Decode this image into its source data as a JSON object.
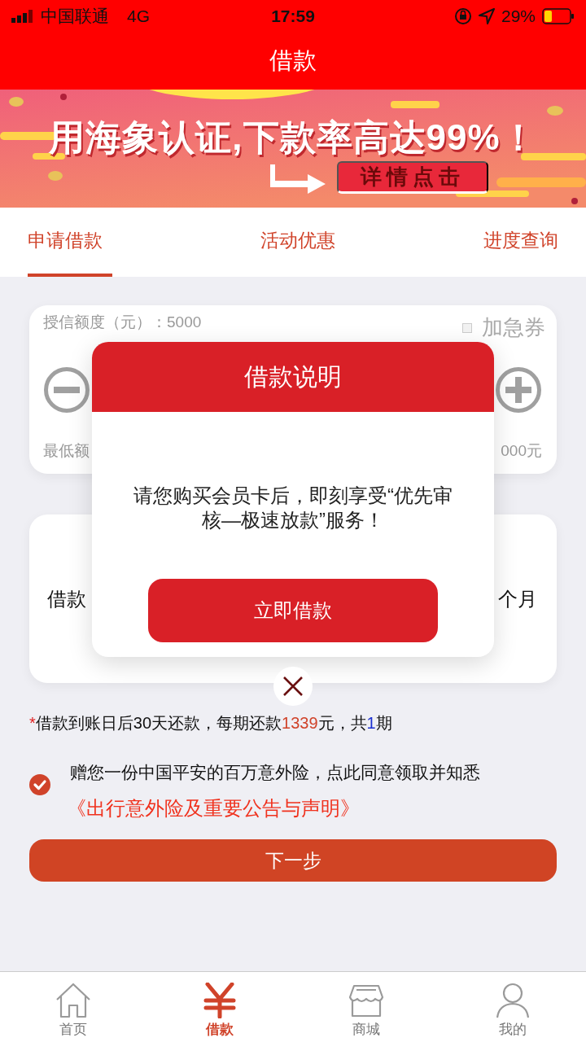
{
  "status_bar": {
    "carrier": "中国联通",
    "network": "4G",
    "time": "17:59",
    "battery": "29%"
  },
  "header": {
    "title": "借款"
  },
  "banner": {
    "kind": "picture",
    "headline": "用海象认证,下款率高达99%！",
    "button": "详情点击"
  },
  "tabs": [
    {
      "label": "申请借款",
      "selected": true
    },
    {
      "label": "活动优惠",
      "selected": false
    },
    {
      "label": "进度查询",
      "selected": false
    }
  ],
  "amount_card": {
    "credit_limit": "授信额度（元）：5000",
    "coupon": {
      "label": "加急券",
      "checked": false
    },
    "min_label": "最低额",
    "max_label": "000元"
  },
  "term_card": {
    "left_label": "借款",
    "right_label": "个月"
  },
  "note": [
    {
      "kind": "asterisk",
      "text": "*"
    },
    {
      "kind": "plain",
      "text": "借款到账日后30天还款，每期还款"
    },
    {
      "kind": "amount",
      "text": "1339"
    },
    {
      "kind": "plain",
      "text": "元，共"
    },
    {
      "kind": "count",
      "text": "1"
    },
    {
      "kind": "plain",
      "text": "期"
    }
  ],
  "agreement": {
    "checked": true,
    "text": "赠您一份中国平安的百万意外险，点此同意领取并知悉",
    "link": "《出行意外险及重要公告与声明》"
  },
  "next_button": "下一步",
  "dialog": {
    "title": "借款说明",
    "message": "请您购买会员卡后，即刻享受“优先审核—极速放款”服务！",
    "button": "立即借款"
  },
  "bottom_nav": [
    {
      "label": "首页",
      "selected": false
    },
    {
      "label": "借款",
      "selected": true
    },
    {
      "label": "商城",
      "selected": false
    },
    {
      "label": "我的",
      "selected": false
    }
  ]
}
